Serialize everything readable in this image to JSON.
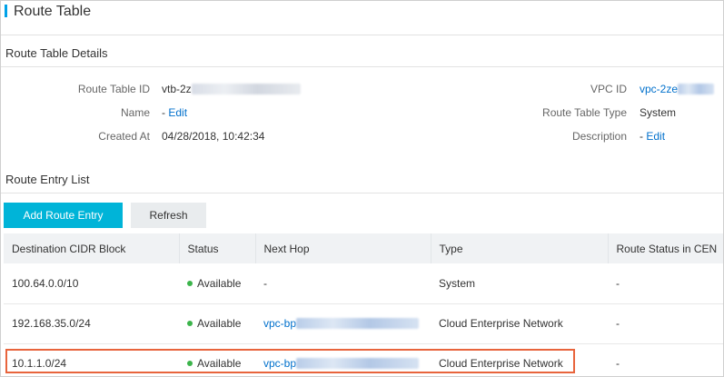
{
  "page": {
    "title": "Route Table"
  },
  "details": {
    "section_title": "Route Table Details",
    "route_table_id_label": "Route Table ID",
    "route_table_id_value": "vtb-2z",
    "name_label": "Name",
    "name_value": "-",
    "name_edit": "Edit",
    "created_at_label": "Created At",
    "created_at_value": "04/28/2018, 10:42:34",
    "vpc_id_label": "VPC ID",
    "vpc_id_value": "vpc-2ze",
    "route_table_type_label": "Route Table Type",
    "route_table_type_value": "System",
    "description_label": "Description",
    "description_value": "-",
    "description_edit": "Edit"
  },
  "entries": {
    "section_title": "Route Entry List",
    "add_button": "Add Route Entry",
    "refresh_button": "Refresh",
    "columns": [
      "Destination CIDR Block",
      "Status",
      "Next Hop",
      "Type",
      "Route Status in CEN"
    ],
    "rows": [
      {
        "cidr": "100.64.0.0/10",
        "status": "Available",
        "next_hop": "-",
        "type": "System",
        "cen_status": "-"
      },
      {
        "cidr": "192.168.35.0/24",
        "status": "Available",
        "next_hop": "vpc-bp",
        "type": "Cloud Enterprise Network",
        "cen_status": "-"
      },
      {
        "cidr": "10.1.1.0/24",
        "status": "Available",
        "next_hop": "vpc-bp",
        "type": "Cloud Enterprise Network",
        "cen_status": "-"
      }
    ]
  },
  "colors": {
    "accent": "#00b4d8",
    "link": "#0070cc",
    "available": "#3cb44b",
    "highlight": "#e8643c"
  }
}
